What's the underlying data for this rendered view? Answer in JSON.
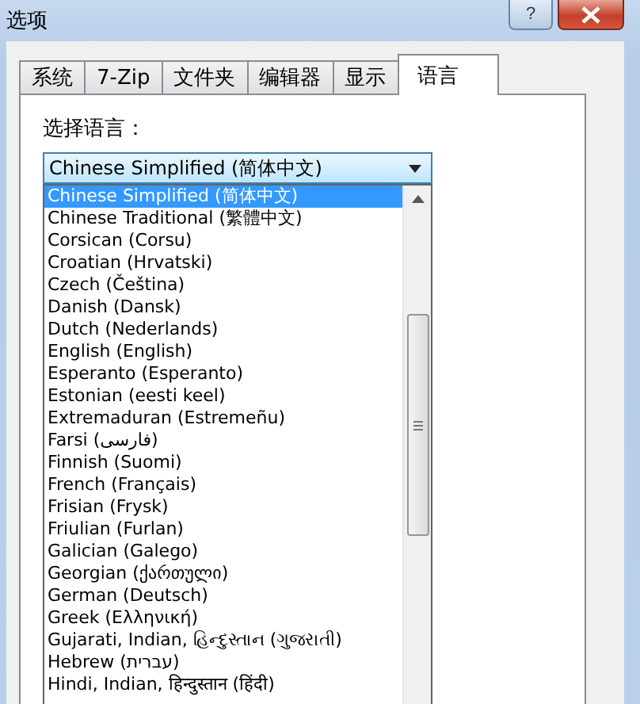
{
  "window": {
    "title": "选项",
    "help_button": "?"
  },
  "tabs": [
    {
      "label": "系统",
      "selected": false
    },
    {
      "label": "7-Zip",
      "selected": false
    },
    {
      "label": "文件夹",
      "selected": false
    },
    {
      "label": "编辑器",
      "selected": false
    },
    {
      "label": "显示",
      "selected": false
    },
    {
      "label": "语言",
      "selected": true
    }
  ],
  "language_label": "选择语言：",
  "language_combo": {
    "value": "Chinese Simplified (简体中文)",
    "expanded": true
  },
  "language_list": [
    {
      "label": "Chinese Simplified (简体中文)",
      "selected": true
    },
    {
      "label": "Chinese Traditional (繁體中文)",
      "selected": false
    },
    {
      "label": "Corsican (Corsu)",
      "selected": false
    },
    {
      "label": "Croatian (Hrvatski)",
      "selected": false
    },
    {
      "label": "Czech (Čeština)",
      "selected": false
    },
    {
      "label": "Danish (Dansk)",
      "selected": false
    },
    {
      "label": "Dutch (Nederlands)",
      "selected": false
    },
    {
      "label": "English (English)",
      "selected": false
    },
    {
      "label": "Esperanto (Esperanto)",
      "selected": false
    },
    {
      "label": "Estonian (eesti keel)",
      "selected": false
    },
    {
      "label": "Extremaduran (Estremeñu)",
      "selected": false
    },
    {
      "label": "Farsi (فارسی)",
      "selected": false
    },
    {
      "label": "Finnish (Suomi)",
      "selected": false
    },
    {
      "label": "French (Français)",
      "selected": false
    },
    {
      "label": "Frisian (Frysk)",
      "selected": false
    },
    {
      "label": "Friulian (Furlan)",
      "selected": false
    },
    {
      "label": "Galician (Galego)",
      "selected": false
    },
    {
      "label": "Georgian (ქართული)",
      "selected": false
    },
    {
      "label": "German (Deutsch)",
      "selected": false
    },
    {
      "label": "Greek (Ελληνική)",
      "selected": false
    },
    {
      "label": "Gujarati, Indian, હિન્દુસ્તાન (ગુજરાતી)",
      "selected": false
    },
    {
      "label": "Hebrew (עברית)",
      "selected": false
    },
    {
      "label": "Hindi, Indian, हिन्दुस्तान (हिंदी)",
      "selected": false
    }
  ]
}
